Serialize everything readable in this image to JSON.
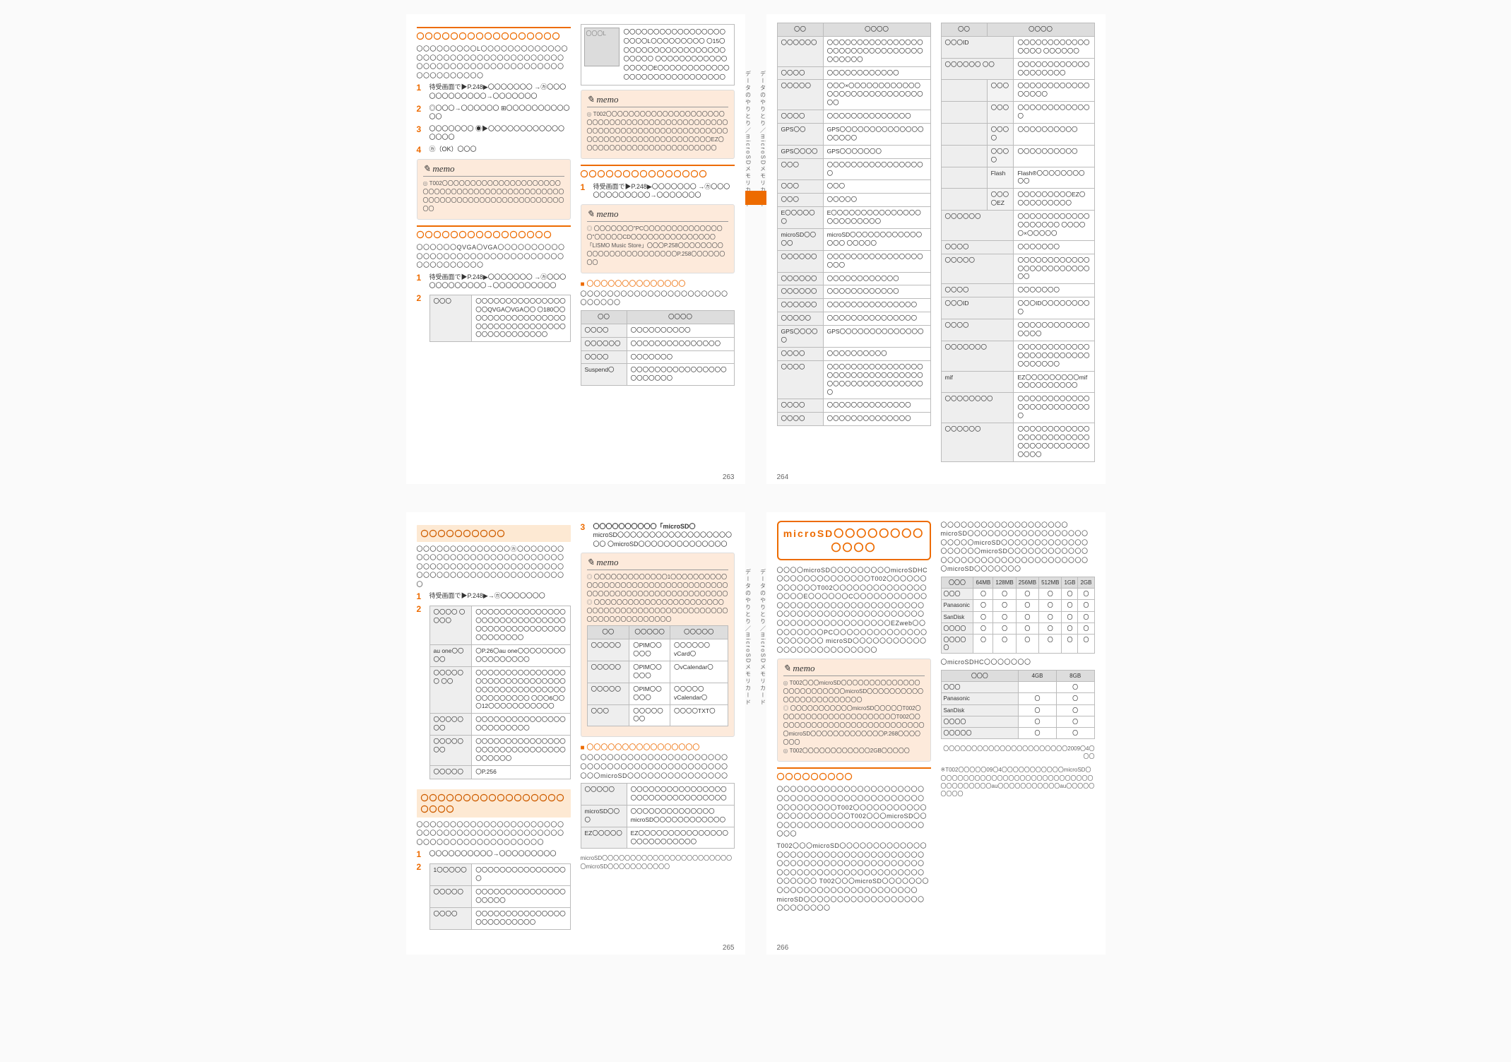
{
  "memo_label": "memo",
  "hand_icon": "☞",
  "pages": {
    "263": "263",
    "264": "264",
    "265": "265",
    "266": "266"
  },
  "side_label": "データのやりとり／microSDメモリカード",
  "p263": {
    "h1": "〇〇〇〇〇〇〇〇〇〇〇〇〇〇〇〇〇",
    "intro": "〇〇〇〇〇〇〇〇〇L〇〇〇〇〇〇〇〇〇〇〇〇〇〇〇〇〇〇〇〇〇〇〇〇〇〇〇〇〇〇〇〇〇〇〇〇〇〇〇〇〇〇〇〇〇〇〇〇〇〇〇〇〇〇〇〇〇〇〇〇〇〇〇〇〇〇〇",
    "s1": "待受画面で▶P.248▶〇〇〇〇〇〇〇\n→㋕〇〇〇〇〇〇〇〇〇〇〇〇→〇〇〇〇〇〇〇",
    "s2": "◎〇〇〇→〇〇〇〇〇〇\n⊞〇〇〇〇〇〇〇〇〇〇〇〇",
    "s3": "〇〇〇〇〇〇〇\n◉▶〇〇〇〇〇〇〇〇〇〇〇〇〇〇〇〇",
    "s4": "㋕（OK）〇〇〇",
    "memo1": "T002〇〇〇〇〇〇〇〇〇〇〇〇〇〇〇〇〇〇〇〇〇〇〇〇〇〇〇〇〇〇〇〇〇〇〇〇〇〇〇〇〇〇〇〇〇〇〇〇〇〇〇〇〇〇〇〇〇〇〇〇〇〇〇〇〇〇〇〇〇〇〇〇〇",
    "h2": "〇〇〇〇〇〇〇〇〇〇〇〇〇〇〇〇",
    "body2": "〇〇〇〇〇〇QVGA〇VGA〇〇〇〇〇〇〇〇〇〇〇〇〇〇〇〇〇〇〇〇〇〇〇〇〇〇〇〇〇〇〇〇〇〇〇〇〇〇〇〇〇〇",
    "s2_1": "待受画面で▶P.248▶〇〇〇〇〇〇〇\n→㋕〇〇〇〇〇〇〇〇〇〇〇〇→〇〇〇〇〇〇〇〇〇〇",
    "tbl2": {
      "r1h": "〇〇〇",
      "r1d": "〇〇〇〇〇〇〇〇〇〇〇〇〇〇〇〇〇QVGA〇VGA〇〇\n〇180〇〇〇〇〇〇〇〇〇〇〇〇〇〇〇〇〇〇〇〇〇〇〇〇〇〇〇〇〇〇〇〇〇〇〇〇〇〇〇〇〇〇〇〇"
    },
    "thumb_l": "〇〇〇L",
    "thumb_desc": "〇〇〇〇〇〇〇〇〇〇〇〇〇〇〇〇〇〇〇〇〇L〇〇〇〇〇〇〇〇〇\n〇15〇〇〇〇〇〇〇〇〇〇〇〇〇〇〇〇〇〇〇〇〇〇〇\n〇〇〇〇〇〇〇〇〇〇〇〇〇〇〇〇〇E〇〇〇〇〇〇〇〇〇〇〇〇〇〇〇〇〇〇〇〇〇〇〇〇〇〇〇〇〇",
    "memo2": "T002〇〇〇〇〇〇〇〇〇〇〇〇〇〇〇〇〇〇〇〇〇〇〇〇〇〇〇〇〇〇〇〇〇〇〇〇〇〇〇〇〇〇〇〇〇〇〇〇〇〇〇〇〇〇〇〇〇〇〇〇〇〇〇〇〇〇〇〇〇〇〇〇〇〇〇〇〇〇〇〇〇〇〇〇〇〇〇〇〇〇〇〇〇EZ〇〇〇〇〇〇〇〇〇〇〇〇〇〇〇〇〇〇〇〇〇〇〇〇",
    "h3": "〇〇〇〇〇〇〇〇〇〇〇〇〇〇〇",
    "s3_1": "待受画面で▶P.248▶〇〇〇〇〇〇〇\n→㋕〇〇〇〇〇〇〇〇〇〇〇〇→〇〇〇〇〇〇〇",
    "memo3a": "〇〇〇〇〇〇〇\"PC〇〇〇〇〇〇〇〇〇〇〇〇〇〇〇\"〇〇〇〇〇CD〇〇〇〇〇〇〇〇〇〇〇〇〇〇〇「LISMO Music Store」〇〇〇P.258〇〇〇〇〇〇〇〇〇〇〇〇〇〇〇〇〇〇〇〇〇〇〇〇P.258〇〇〇〇〇〇〇〇",
    "sub3": "〇〇〇〇〇〇〇〇〇〇〇〇〇〇",
    "body3": "〇〇〇〇〇〇〇〇〇〇〇〇〇〇〇〇〇〇〇〇〇〇〇〇〇〇〇〇",
    "tbl3": {
      "th1": "〇〇",
      "th2": "〇〇〇〇",
      "r1h": "〇〇〇〇",
      "r1d": "〇〇〇〇〇〇〇〇〇〇",
      "r2h": "〇〇〇〇〇〇",
      "r2d": "〇〇〇〇〇〇〇〇〇〇〇〇〇〇〇",
      "r3h": "〇〇〇〇",
      "r3d": "〇〇〇〇〇〇〇",
      "r4h": "Suspend〇",
      "r4d": "〇〇〇〇〇〇〇〇〇〇〇〇〇〇〇〇〇〇〇〇〇〇〇"
    }
  },
  "p264": {
    "tbl1": {
      "th1": "〇〇",
      "th2": "〇〇〇〇",
      "rows": [
        [
          "〇〇〇〇〇〇",
          "〇〇〇〇〇〇〇〇〇〇〇〇〇〇〇〇〇〇〇〇〇〇〇〇〇〇〇〇〇〇〇〇〇〇〇〇〇〇"
        ],
        [
          "〇〇〇〇",
          "〇〇〇〇〇〇〇〇〇〇〇〇"
        ],
        [
          "〇〇〇〇〇",
          "〇〇〇×〇〇〇〇〇〇〇〇〇〇〇〇〇〇〇〇〇〇〇〇〇〇〇〇〇〇〇〇〇〇"
        ],
        [
          "〇〇〇〇",
          "〇〇〇〇〇〇〇〇〇〇〇〇〇〇"
        ],
        [
          "GPS〇〇",
          "GPS〇〇〇〇〇〇〇〇〇〇〇〇〇〇〇〇〇〇〇"
        ],
        [
          "GPS〇〇〇〇",
          "GPS〇〇〇〇〇〇〇"
        ],
        [
          "〇〇〇",
          "〇〇〇〇〇〇〇〇〇〇〇〇〇〇〇〇〇"
        ],
        [
          "〇〇〇",
          "〇〇〇"
        ],
        [
          "〇〇〇",
          "〇〇〇〇〇"
        ],
        [
          "E〇〇〇〇〇〇",
          "E〇〇〇〇〇〇〇〇〇〇〇〇〇〇〇〇〇〇〇〇〇〇〇〇"
        ],
        [
          "microSD〇〇〇〇",
          "microSD〇〇〇〇〇〇〇〇〇〇〇〇〇〇〇\n〇〇〇〇〇"
        ],
        [
          "〇〇〇〇〇〇",
          "〇〇〇〇〇〇〇〇〇〇〇〇〇〇〇〇〇〇〇"
        ],
        [
          "〇〇〇〇〇〇",
          "〇〇〇〇〇〇〇〇〇〇〇〇"
        ],
        [
          "〇〇〇〇〇〇",
          "〇〇〇〇〇〇〇〇〇〇〇〇"
        ],
        [
          "〇〇〇〇〇〇",
          "〇〇〇〇〇〇〇〇〇〇〇〇〇〇〇"
        ],
        [
          "〇〇〇〇〇",
          "〇〇〇〇〇〇〇〇〇〇〇〇〇〇〇"
        ],
        [
          "GPS〇〇〇〇〇",
          "GPS〇〇〇〇〇〇〇〇〇〇〇〇〇〇"
        ],
        [
          "〇〇〇〇",
          "〇〇〇〇〇〇〇〇〇〇"
        ],
        [
          "〇〇〇〇",
          "〇〇〇〇〇〇〇〇〇〇〇〇〇〇〇〇〇〇〇〇〇〇〇〇〇〇〇〇〇〇〇〇〇〇〇〇〇〇〇〇〇〇〇〇〇〇〇〇〇"
        ],
        [
          "〇〇〇〇",
          "〇〇〇〇〇〇〇〇〇〇〇〇〇〇"
        ],
        [
          "〇〇〇〇",
          "〇〇〇〇〇〇〇〇〇〇〇〇〇〇"
        ]
      ]
    },
    "tbl2": {
      "th1": "〇〇",
      "th2": "〇〇〇〇",
      "rows": [
        [
          "〇〇〇ID",
          "",
          "〇〇〇〇〇〇〇〇〇〇〇〇〇〇〇〇\n〇〇〇〇〇〇"
        ],
        [
          "〇〇〇〇〇〇\n〇〇",
          "",
          "〇〇〇〇〇〇〇〇〇〇〇〇〇〇〇〇〇〇〇〇"
        ],
        [
          "",
          "〇〇〇",
          "〇〇〇〇〇〇〇〇〇〇〇〇〇〇〇〇〇"
        ],
        [
          "",
          "〇〇〇",
          "〇〇〇〇〇〇〇〇〇〇〇〇〇"
        ],
        [
          "",
          "〇〇〇〇",
          "〇〇〇〇〇〇〇〇〇〇"
        ],
        [
          "",
          "〇〇〇〇",
          "〇〇〇〇〇〇〇〇〇〇"
        ],
        [
          "",
          "Flash",
          "Flash®〇〇〇〇〇〇〇〇〇〇"
        ],
        [
          "",
          "〇〇〇〇EZ",
          "〇〇〇〇〇〇〇〇〇EZ〇〇〇〇〇〇〇〇〇〇"
        ],
        [
          "〇〇〇〇〇〇",
          "",
          "〇〇〇〇〇〇〇〇〇〇〇〇〇〇〇〇〇〇〇\n〇〇〇〇〇×〇〇〇〇〇"
        ],
        [
          "〇〇〇〇",
          "",
          "〇〇〇〇〇〇〇"
        ],
        [
          "〇〇〇〇〇",
          "",
          "〇〇〇〇〇〇〇〇〇〇〇〇〇〇〇〇〇〇〇〇〇〇〇〇〇〇"
        ],
        [
          "〇〇〇〇",
          "",
          "〇〇〇〇〇〇〇"
        ],
        [
          "〇〇〇ID",
          "",
          "〇〇〇ID〇〇〇〇〇〇〇〇〇"
        ],
        [
          "〇〇〇〇",
          "",
          "〇〇〇〇〇〇〇〇〇〇〇〇〇〇〇〇"
        ],
        [
          "〇〇〇〇〇〇〇",
          "",
          "〇〇〇〇〇〇〇〇〇〇〇〇〇〇〇〇〇〇〇〇〇〇〇〇〇〇〇〇〇〇〇"
        ],
        [
          "mif",
          "",
          "EZ〇〇〇〇〇〇〇〇〇mif〇〇〇〇〇〇〇〇〇〇"
        ],
        [
          "〇〇〇〇〇〇〇〇",
          "",
          "〇〇〇〇〇〇〇〇〇〇〇〇〇〇〇〇〇〇〇〇〇〇〇〇〇"
        ],
        [
          "〇〇〇〇〇〇",
          "",
          "〇〇〇〇〇〇〇〇〇〇〇〇〇〇〇〇〇〇〇〇〇〇〇〇〇〇〇〇〇〇〇〇〇〇〇〇〇〇〇〇"
        ]
      ]
    }
  },
  "p265": {
    "h1": "〇〇〇〇〇〇〇〇〇〇",
    "body1": "〇〇〇〇〇〇〇〇〇〇〇〇〇〇㋕〇〇〇〇〇〇〇〇〇〇〇〇〇〇〇〇〇〇〇〇〇〇〇〇〇〇〇〇〇〇〇〇〇〇〇〇〇〇〇〇〇〇〇〇〇〇〇〇〇〇〇〇〇〇〇〇〇〇〇〇〇〇〇〇〇〇〇〇〇〇〇〇〇〇",
    "s1": "待受画面で▶P.248▶→㋕〇〇〇〇〇〇〇",
    "tbl1": {
      "rows": [
        [
          "〇〇〇〇\n〇〇〇〇",
          "〇〇〇〇〇〇〇〇〇〇〇〇〇〇〇〇〇〇〇〇〇〇〇〇〇〇〇〇〇〇〇〇〇〇〇〇〇〇〇〇〇〇〇〇〇〇〇〇〇〇〇〇〇"
        ],
        [
          "au one〇〇〇〇",
          "〇P.26〇au one〇〇〇〇〇〇〇〇〇〇〇〇〇〇〇〇〇"
        ],
        [
          "〇〇〇〇〇〇\n〇〇",
          "〇〇〇〇〇〇〇〇〇〇〇〇〇〇〇〇〇〇〇〇〇〇〇〇〇〇〇〇〇〇〇〇〇〇〇〇〇〇〇〇〇〇〇〇〇〇〇〇〇〇〇〇〇〇\n〇〇〇6〇〇〇12〇〇〇〇〇〇〇〇〇〇〇"
        ],
        [
          "〇〇〇〇〇〇〇",
          "〇〇〇〇〇〇〇〇〇〇〇〇〇〇〇〇〇〇〇〇〇〇〇〇"
        ],
        [
          "〇〇〇〇〇〇〇",
          "〇〇〇〇〇〇〇〇〇〇〇〇〇〇〇〇〇〇〇〇〇〇〇〇〇〇〇〇〇〇〇〇〇〇〇〇"
        ],
        [
          "〇〇〇〇〇",
          "〇P.256"
        ]
      ]
    },
    "h2": "〇〇〇〇〇〇〇〇〇〇〇〇〇〇〇〇〇〇〇〇〇",
    "body2": "〇〇〇〇〇〇〇〇〇〇〇〇〇〇〇〇〇〇〇〇〇〇〇〇〇〇〇〇〇〇〇〇〇〇〇〇〇〇〇〇〇〇〇〇〇〇〇〇〇〇〇〇〇〇〇〇〇〇〇〇〇〇〇",
    "s2_1": "〇〇〇〇〇〇〇〇〇〇→〇〇〇〇〇〇〇〇〇",
    "tbl2": {
      "rows": [
        [
          "1〇〇〇〇〇",
          "〇〇〇〇〇〇〇〇〇〇〇〇〇〇〇〇"
        ],
        [
          "〇〇〇〇〇",
          "〇〇〇〇〇〇〇〇〇〇〇〇〇〇〇〇〇〇〇〇"
        ],
        [
          "〇〇〇〇",
          "〇〇〇〇〇〇〇〇〇〇〇〇〇〇〇〇〇〇〇〇〇〇〇〇〇"
        ]
      ]
    },
    "s3": "〇〇〇〇〇〇〇〇〇〇「microSD〇",
    "s3_body": "microSD〇〇〇〇〇〇〇〇〇〇〇〇〇〇〇〇〇〇〇〇\n〇microSD〇〇〇〇〇〇〇〇〇〇〇〇〇〇",
    "memo3a": "〇〇〇〇〇〇〇〇〇〇〇〇〇1〇〇〇〇〇〇〇〇〇〇〇〇〇〇〇〇〇〇〇〇〇〇〇〇〇〇〇〇〇〇〇〇〇〇〇〇〇〇〇〇〇〇〇〇〇〇〇〇〇〇〇〇〇〇〇〇〇〇〇〇",
    "memo3b": "〇〇〇〇〇〇〇〇〇〇〇〇〇〇〇〇〇〇〇〇〇〇〇〇〇〇〇〇〇〇〇〇〇〇〇〇〇〇〇〇〇〇〇〇〇〇〇〇〇〇〇〇〇〇〇〇〇〇〇〇〇〇〇",
    "fmt_tbl": {
      "th1": "〇〇",
      "th2": "〇〇〇〇〇",
      "th3": "〇〇〇〇〇",
      "rows": [
        [
          "〇〇〇〇〇",
          "〇PIM〇〇〇〇〇",
          "〇〇〇〇〇〇vCard〇"
        ],
        [
          "〇〇〇〇〇",
          "〇PIM〇〇〇〇〇",
          "〇vCalendar〇"
        ],
        [
          "〇〇〇〇〇",
          "〇PIM〇〇〇〇〇",
          "〇〇〇〇〇vCalendar〇"
        ],
        [
          "〇〇〇",
          "〇〇〇〇〇〇〇",
          "〇〇〇〇TXT〇"
        ]
      ]
    },
    "sub4": "〇〇〇〇〇〇〇〇〇〇〇〇〇〇〇〇",
    "body4": "〇〇〇〇〇〇〇〇〇〇〇〇〇〇〇〇〇〇〇〇〇〇〇〇〇〇〇〇〇〇〇〇〇〇〇〇〇〇〇〇〇〇〇〇〇〇〇microSD〇〇〇〇〇〇〇〇〇〇〇〇〇〇〇",
    "tbl4": {
      "rows": [
        [
          "〇〇〇〇〇",
          "〇〇〇〇〇〇〇〇〇〇〇〇〇〇〇〇〇〇〇〇〇〇〇〇〇〇〇〇〇〇〇〇"
        ],
        [
          "microSD〇〇〇",
          "〇〇〇〇〇〇〇〇〇〇〇〇〇〇microSD〇〇〇〇〇〇〇〇〇〇〇〇"
        ],
        [
          "EZ〇〇〇〇〇",
          "EZ〇〇〇〇〇〇〇〇〇〇〇〇〇〇〇〇〇〇〇〇〇〇〇〇〇〇"
        ]
      ]
    },
    "foot4": "microSD〇〇〇〇〇〇〇〇〇〇〇〇〇〇〇〇〇〇〇〇〇〇〇〇microSD〇〇〇〇〇〇〇〇〇〇〇"
  },
  "p266": {
    "sd_head": "microSD〇〇〇〇〇〇〇〇〇〇〇〇",
    "intro": "〇〇〇〇microSD〇〇〇〇〇〇〇〇〇microSDHC〇〇〇〇〇〇〇〇〇〇〇〇〇〇T002〇〇〇〇〇〇〇〇〇〇〇〇T002〇〇〇〇〇〇〇〇〇〇〇〇〇〇〇〇〇〇E〇〇〇〇〇〇C〇〇〇〇〇〇〇〇〇〇〇〇〇〇〇〇〇〇〇〇〇〇〇〇〇〇〇〇〇〇〇〇〇〇〇〇〇〇〇〇〇〇〇〇〇〇〇〇〇〇〇〇〇〇〇〇〇〇〇〇〇〇〇〇〇〇〇〇〇〇〇〇EZweb〇〇〇〇〇〇〇〇〇PC〇〇〇〇〇〇〇〇〇〇〇〇〇〇〇〇〇〇〇〇〇\nmicroSD〇〇〇〇〇〇〇〇〇〇〇〇〇〇〇〇〇〇〇〇〇〇〇〇〇〇",
    "memo1": "T002〇〇〇microSD〇〇〇〇〇〇〇〇〇〇〇〇〇〇〇〇〇〇〇〇〇〇〇〇〇microSD〇〇〇〇〇〇〇〇〇〇〇〇〇〇〇〇〇〇〇〇〇〇〇〇",
    "memo2": "〇〇〇〇〇〇〇〇〇〇〇microSD〇〇〇〇〇T002〇〇〇〇〇〇〇〇〇〇〇〇〇〇〇〇〇〇〇〇〇T002〇〇〇〇〇〇〇〇〇〇〇〇〇〇〇〇〇〇〇〇〇〇〇〇〇〇〇〇microSD〇〇〇〇〇〇〇〇〇〇〇〇〇P.268〇〇〇〇〇〇〇",
    "memo3": "T002〇〇〇〇〇〇〇〇〇〇〇〇2GB〇〇〇〇〇",
    "h2": "〇〇〇〇〇〇〇〇〇",
    "body2a": "〇〇〇〇〇〇〇〇〇〇〇〇〇〇〇〇〇〇〇〇〇〇〇〇〇〇〇〇〇〇〇〇〇〇〇〇〇〇〇〇〇〇〇〇〇〇〇〇〇〇〇〇〇T002〇〇〇〇〇〇〇〇〇〇〇〇〇〇〇〇〇〇〇〇〇〇T002〇〇〇microSD〇〇〇〇〇〇〇〇〇〇〇〇〇〇〇〇〇〇〇〇〇〇〇〇〇〇〇",
    "body2b": "T002〇〇〇microSD〇〇〇〇〇〇〇〇〇〇〇〇〇〇〇〇〇〇〇〇〇〇〇〇〇〇〇〇〇〇〇〇〇〇〇〇〇〇〇〇〇〇〇〇〇〇〇〇〇〇〇〇〇〇〇〇〇〇〇〇〇〇〇〇〇〇〇〇〇〇〇〇〇〇〇〇〇〇〇〇〇〇〇〇〇\nT002〇〇〇microSD〇〇〇〇〇〇〇〇〇〇〇〇〇〇〇〇〇〇〇〇〇〇〇〇〇〇〇〇microSD〇〇〇〇〇〇〇〇〇〇〇〇〇〇〇〇〇〇〇〇〇〇〇〇〇〇",
    "intro_r": "〇〇〇〇〇〇〇〇〇〇〇〇〇〇〇〇〇〇〇microSD〇〇〇〇〇〇〇〇〇〇〇〇〇〇〇〇〇〇〇〇〇〇〇microSD〇〇〇〇〇〇〇〇〇〇〇〇〇〇〇〇〇〇〇microSD〇〇〇〇〇〇〇〇〇〇〇〇〇〇〇〇〇〇〇〇〇〇〇〇〇〇〇〇〇〇〇〇〇〇\n〇microSD〇〇〇〇〇〇〇",
    "compat1": {
      "th": [
        "〇〇〇",
        "64MB",
        "128MB",
        "256MB",
        "512MB",
        "1GB",
        "2GB"
      ],
      "rows": [
        [
          "〇〇〇",
          "〇",
          "〇",
          "〇",
          "〇",
          "〇",
          "〇"
        ],
        [
          "Panasonic",
          "〇",
          "〇",
          "〇",
          "〇",
          "〇",
          "〇"
        ],
        [
          "SanDisk",
          "〇",
          "〇",
          "〇",
          "〇",
          "〇",
          "〇"
        ],
        [
          "〇〇〇〇",
          "〇",
          "〇",
          "〇",
          "〇",
          "〇",
          "〇"
        ],
        [
          "〇〇〇〇〇",
          "〇",
          "〇",
          "〇",
          "〇",
          "〇",
          "〇"
        ]
      ]
    },
    "compat2_title": "〇microSDHC〇〇〇〇〇〇〇",
    "compat2": {
      "th": [
        "〇〇〇",
        "4GB",
        "8GB"
      ],
      "rows": [
        [
          "〇〇〇",
          "",
          "〇"
        ],
        [
          "Panasonic",
          "〇",
          "〇"
        ],
        [
          "SanDisk",
          "〇",
          "〇"
        ],
        [
          "〇〇〇〇",
          "〇",
          "〇"
        ],
        [
          "〇〇〇〇〇",
          "〇",
          "〇"
        ]
      ]
    },
    "date_note": "〇〇〇〇〇〇〇〇〇〇〇〇〇〇〇〇〇〇〇〇〇〇2009〇4〇〇〇",
    "foot_note": "※T002〇〇〇〇〇09〇4〇〇〇〇〇〇〇〇〇〇〇microSD〇〇〇〇〇〇〇〇〇〇〇〇〇〇〇〇〇〇〇〇〇〇〇〇〇〇〇〇〇〇〇〇〇〇〇〇〇au〇〇〇〇〇〇〇〇〇〇〇au〇〇〇〇〇〇〇〇〇"
  }
}
